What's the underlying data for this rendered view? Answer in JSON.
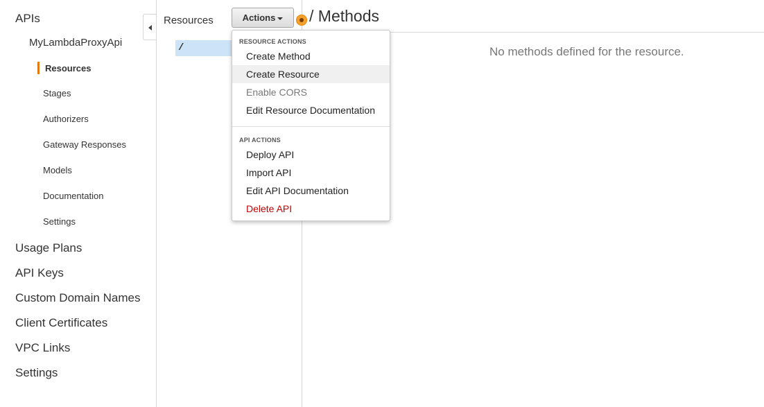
{
  "left_nav": {
    "apis": "APIs",
    "api_name": "MyLambdaProxyApi",
    "sub_items": [
      "Resources",
      "Stages",
      "Authorizers",
      "Gateway Responses",
      "Models",
      "Documentation",
      "Settings"
    ],
    "active_item": "Resources",
    "bottom_items": [
      "Usage Plans",
      "API Keys",
      "Custom Domain Names",
      "Client Certificates",
      "VPC Links",
      "Settings"
    ]
  },
  "resources": {
    "title": "Resources",
    "actions_label": "Actions",
    "tree": [
      "/"
    ]
  },
  "methods": {
    "title": "/ Methods",
    "empty_message": "No methods defined for the resource."
  },
  "actions_menu": {
    "resource_header": "RESOURCE ACTIONS",
    "resource_items": [
      "Create Method",
      "Create Resource",
      "Enable CORS",
      "Edit Resource Documentation"
    ],
    "highlighted_item": "Create Resource",
    "disabled_item": "Enable CORS",
    "api_header": "API ACTIONS",
    "api_items": [
      "Deploy API",
      "Import API",
      "Edit API Documentation",
      "Delete API"
    ],
    "danger_item": "Delete API"
  },
  "colors": {
    "accent": "#e47911",
    "selected_row": "#cde3f7",
    "danger": "#c40000"
  }
}
